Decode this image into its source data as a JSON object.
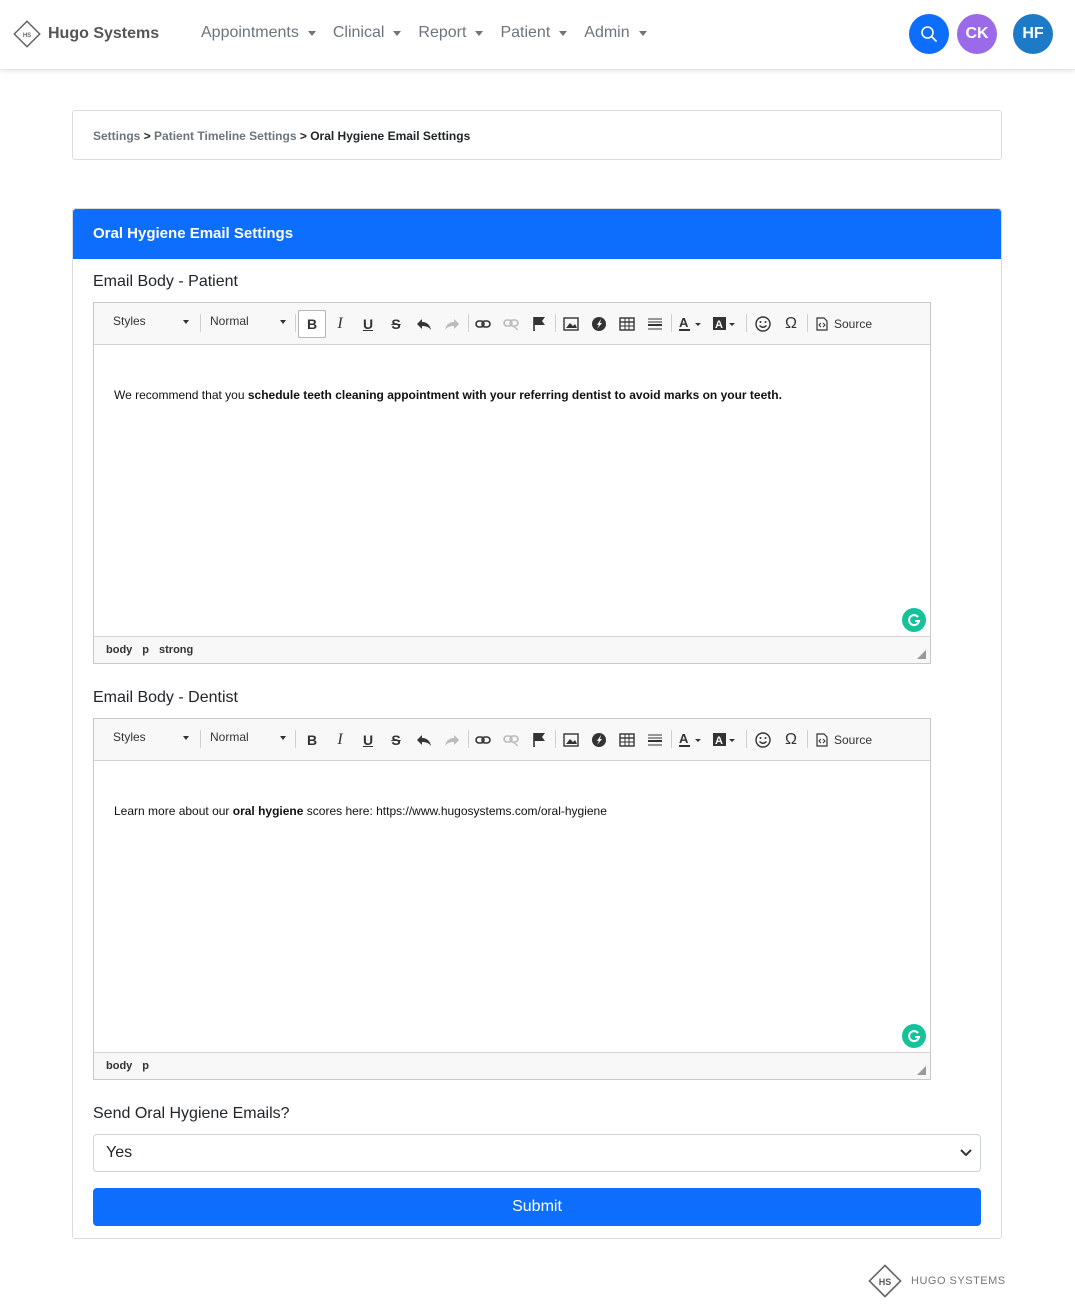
{
  "brand": {
    "logo_text": "HS",
    "name": "Hugo Systems"
  },
  "nav": {
    "items": [
      {
        "label": "Appointments"
      },
      {
        "label": "Clinical"
      },
      {
        "label": "Report"
      },
      {
        "label": "Patient"
      },
      {
        "label": "Admin"
      }
    ],
    "search_icon": "search-icon",
    "avatars": [
      {
        "initials": "CK",
        "color": "#9b6ae8"
      },
      {
        "initials": "HF",
        "color": "#1c7ac6"
      }
    ]
  },
  "breadcrumb": {
    "items": [
      "Settings",
      "Patient Timeline Settings",
      "Oral Hygiene Email Settings"
    ],
    "separator": ">"
  },
  "card": {
    "title": "Oral Hygiene Email Settings"
  },
  "editor_toolbar": {
    "styles_label": "Styles",
    "format_label": "Normal",
    "source_label": "Source"
  },
  "patient_editor": {
    "label": "Email Body - Patient",
    "text_pre": "We recommend that you ",
    "text_bold": "schedule teeth cleaning appointment with your referring dentist to avoid marks on your teeth.",
    "path": [
      "body",
      "p",
      "strong"
    ]
  },
  "dentist_editor": {
    "label": "Email Body - Dentist",
    "text_pre": "Learn more about our ",
    "text_bold": "oral hygiene",
    "text_post": " scores here: https://www.hugosystems.com/oral-hygiene",
    "path": [
      "body",
      "p"
    ]
  },
  "send_emails": {
    "label": "Send Oral Hygiene Emails?",
    "value": "Yes"
  },
  "submit_label": "Submit",
  "footer": {
    "logo_text": "HS",
    "name": "HUGO SYSTEMS"
  },
  "colors": {
    "primary": "#0d6efd",
    "grammarly": "#15c39a"
  }
}
